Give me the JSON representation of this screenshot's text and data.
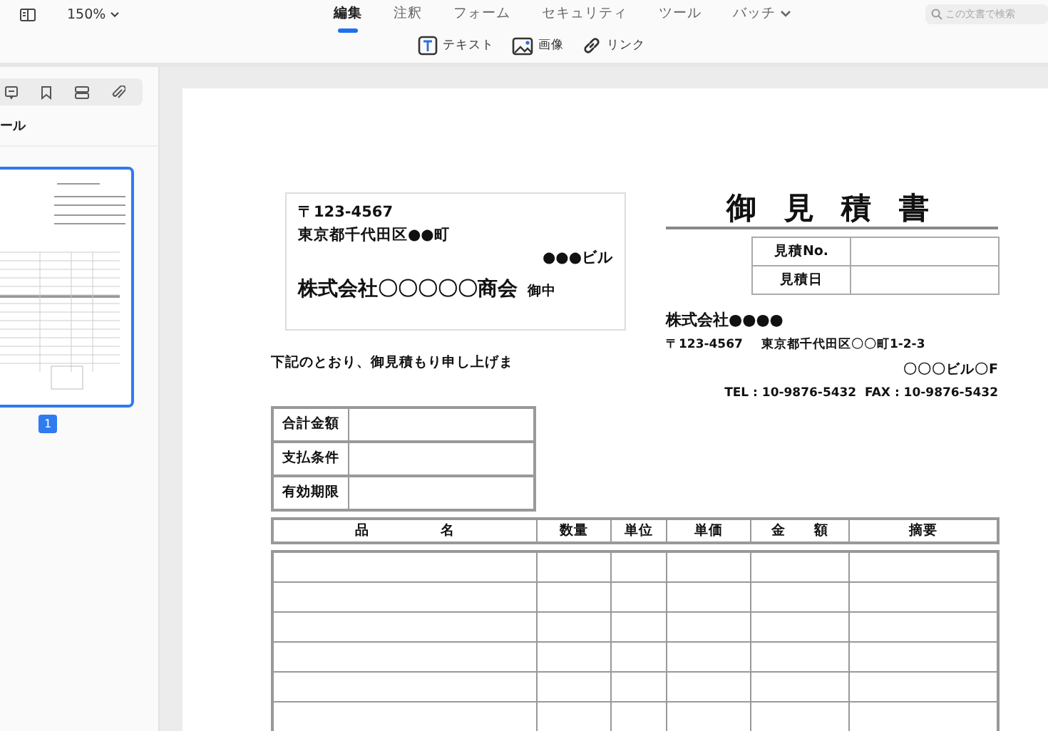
{
  "toolbar": {
    "zoom": "150%",
    "tabs": [
      {
        "label": "編集",
        "selected": true
      },
      {
        "label": "注釈",
        "selected": false
      },
      {
        "label": "フォーム",
        "selected": false
      },
      {
        "label": "セキュリティ",
        "selected": false
      },
      {
        "label": "ツール",
        "selected": false
      },
      {
        "label": "バッチ",
        "selected": false,
        "dropdown": true
      }
    ],
    "search": {
      "placeholder": "この文書で検索"
    },
    "tools": [
      {
        "kind": "text",
        "label": "テキスト"
      },
      {
        "kind": "image",
        "label": "画像"
      },
      {
        "kind": "link",
        "label": "リンク"
      }
    ]
  },
  "sidebar": {
    "title": "ール",
    "pages": [
      {
        "number": "1",
        "selected": true
      }
    ]
  },
  "document": {
    "recipient": {
      "postal": "〒123-4567",
      "address": "東京都千代田区●●町",
      "building": "●●●ビル",
      "company": "株式会社〇〇〇〇〇商会",
      "honorific": "御中"
    },
    "intro": "下記のとおり、御見積もり申し上げま",
    "title": "御 見 積 書",
    "meta_rows": [
      {
        "label": "見積No."
      },
      {
        "label": "見積日"
      }
    ],
    "issuer": {
      "company": "株式会社●●●●",
      "postal": "〒123-4567",
      "address": "東京都千代田区〇〇町1-2-3",
      "building": "〇〇〇ビル〇F",
      "contact": "TEL : 10-9876-5432  FAX : 10-9876-5432"
    },
    "summary_rows": [
      {
        "label": "合計金額"
      },
      {
        "label": "支払条件"
      },
      {
        "label": "有効期限"
      }
    ],
    "items_table": {
      "columns": [
        "品　　　　　名",
        "数量",
        "単位",
        "単価",
        "金　　額",
        "摘要"
      ]
    }
  }
}
